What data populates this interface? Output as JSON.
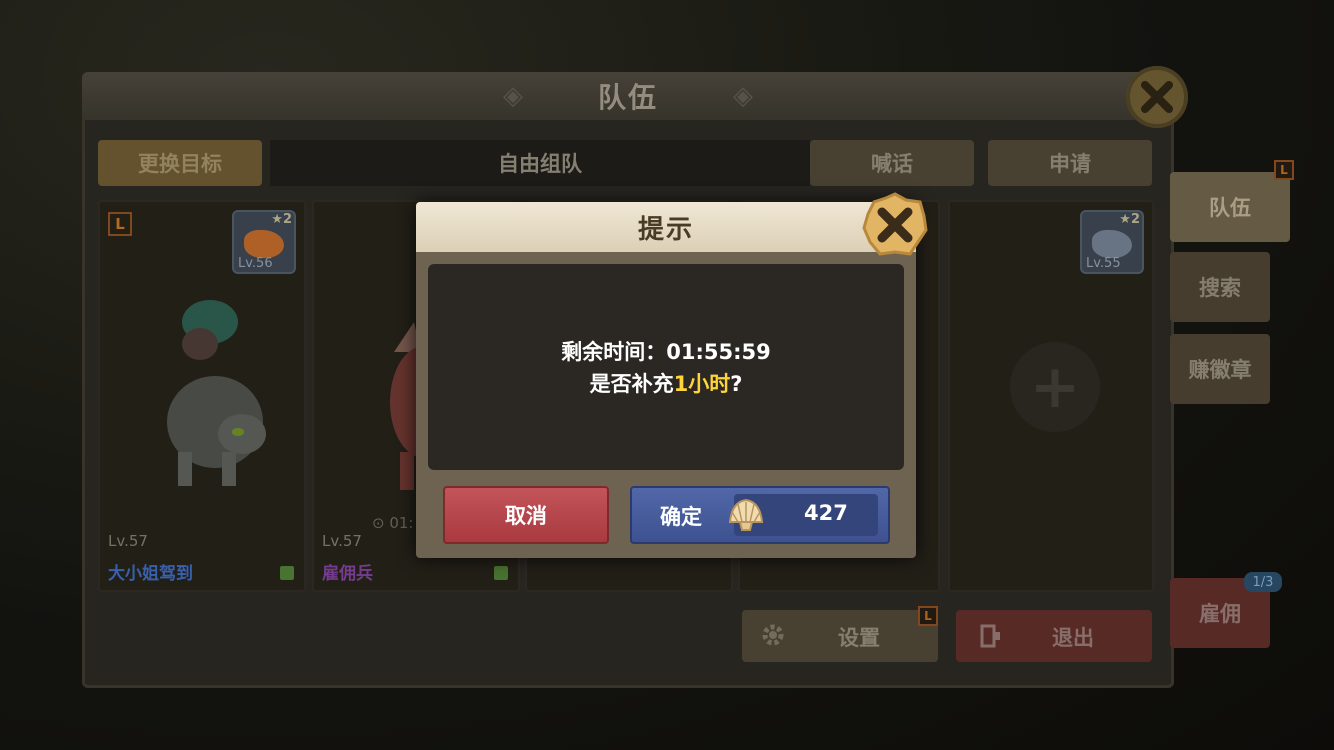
{
  "panel": {
    "title": "队伍",
    "change_target_label": "更换目标",
    "free_team_label": "自由组队",
    "shout_label": "喊话",
    "apply_label": "申请",
    "settings_label": "设置",
    "exit_label": "退出",
    "leader_tag": "L"
  },
  "members": [
    {
      "level": "Lv.57",
      "name": "大小姐驾到",
      "name_color": "#3d66b8",
      "pet_level": "Lv.56",
      "pet_star": "★2"
    },
    {
      "level": "Lv.57",
      "name": "雇佣兵",
      "name_color": "#7b3f96",
      "timer_fragment": "⊙ 01:"
    }
  ],
  "right_pet": {
    "pet_level": "Lv.55",
    "pet_star": "★2"
  },
  "side_tabs": {
    "team": "队伍",
    "search": "搜索",
    "earn_badge": "赚徽章",
    "hire": "雇佣",
    "hire_count": "1/3"
  },
  "dialog": {
    "title": "提示",
    "line1": "剩余时间：01:55:59",
    "line2_prefix": "是否补充",
    "line2_highlight": "1小时",
    "line2_suffix": "?",
    "cancel_label": "取消",
    "confirm_label": "确定",
    "price": "427",
    "currency_icon": "shell-icon"
  },
  "colors": {
    "cancel": "#b8474c",
    "confirm": "#4a5fa0",
    "highlight": "#ffd43a",
    "header": "#e8dfcb"
  }
}
